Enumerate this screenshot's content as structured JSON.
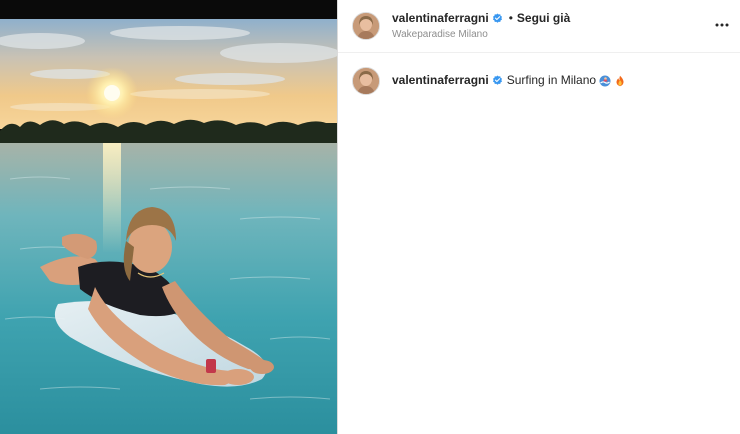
{
  "post": {
    "username": "valentinaferragni",
    "verified": true,
    "separator": "•",
    "follow_label": "Segui già",
    "location": "Wakeparadise Milano",
    "more_icon": "more-horizontal-icon",
    "caption": {
      "username": "valentinaferragni",
      "text": "Surfing in Milano",
      "emojis": [
        "surfer-emoji",
        "fire-emoji"
      ]
    },
    "colors": {
      "verified_badge": "#3897f0",
      "text": "#262626",
      "muted": "#8e8e8e"
    }
  }
}
